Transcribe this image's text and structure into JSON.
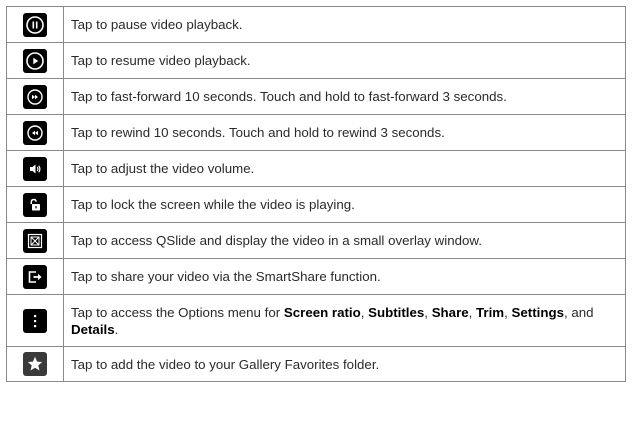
{
  "rows": [
    {
      "icon": "pause-icon",
      "text": "Tap to pause video playback."
    },
    {
      "icon": "play-icon",
      "text": "Tap to resume video playback."
    },
    {
      "icon": "fast-forward-icon",
      "text": "Tap to fast-forward 10 seconds. Touch and hold to fast-forward 3 seconds."
    },
    {
      "icon": "rewind-icon",
      "text": "Tap to rewind 10 seconds. Touch and hold to rewind 3 seconds."
    },
    {
      "icon": "volume-icon",
      "text": "Tap to adjust the video volume."
    },
    {
      "icon": "lock-icon",
      "text": "Tap to lock the screen while the video is playing."
    },
    {
      "icon": "qslide-icon",
      "text": "Tap to access QSlide and display the video in a small overlay window."
    },
    {
      "icon": "smartshare-icon",
      "text": "Tap to share your video via the SmartShare function."
    },
    {
      "icon": "options-menu-icon",
      "text_prefix": "Tap to access the Options menu for ",
      "opt1": "Screen ratio",
      "sep1": ", ",
      "opt2": "Subtitles",
      "sep2": ", ",
      "opt3": "Share",
      "sep3": ", ",
      "opt4": "Trim",
      "sep4": ", ",
      "opt5": "Settings",
      "sep5": ", and ",
      "opt6": "Details",
      "end": "."
    },
    {
      "icon": "star-icon",
      "text": "Tap to add the video to your Gallery Favorites folder."
    }
  ]
}
